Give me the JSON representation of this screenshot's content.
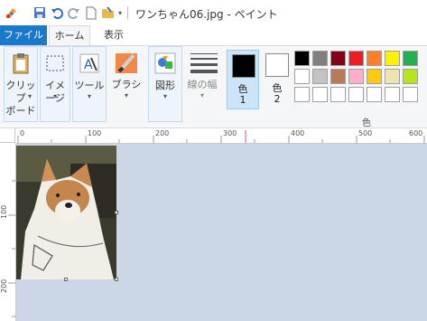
{
  "window": {
    "title": "ワンちゃん06.jpg - ペイント"
  },
  "quick_access": [
    "paint-app-icon",
    "save-icon",
    "undo-icon",
    "redo-icon",
    "new-file-icon",
    "open-folder-icon",
    "customize-qat-icon"
  ],
  "tabs": {
    "file": "ファイル",
    "home": "ホーム",
    "view": "表示"
  },
  "ribbon": {
    "clipboard": {
      "line1": "クリップ",
      "line2": "ボード"
    },
    "image": {
      "line1": "イメージ"
    },
    "tools": {
      "line1": "ツール"
    },
    "brush": {
      "line1": "ブラシ"
    },
    "shapes": {
      "line1": "図形"
    },
    "line_width": {
      "line1": "線の幅"
    },
    "color1": {
      "line1": "色",
      "line2": "1",
      "color": "#000000"
    },
    "color2": {
      "line1": "色",
      "line2": "2",
      "color": "#ffffff"
    },
    "colors_group_label": "色",
    "palette_row1": [
      "#000000",
      "#7f7f7f",
      "#880015",
      "#ed1c24",
      "#ff7f27",
      "#fff200",
      "#22b14c"
    ],
    "palette_row2": [
      "#ffffff",
      "#c3c3c3",
      "#b97a57",
      "#ffaec9",
      "#ffc90e",
      "#efe4b0",
      "#b5e61d"
    ]
  },
  "ruler": {
    "top_labels": [
      "0",
      "100",
      "200",
      "300",
      "400",
      "500",
      "600"
    ],
    "left_labels": [
      "100",
      "200"
    ]
  }
}
